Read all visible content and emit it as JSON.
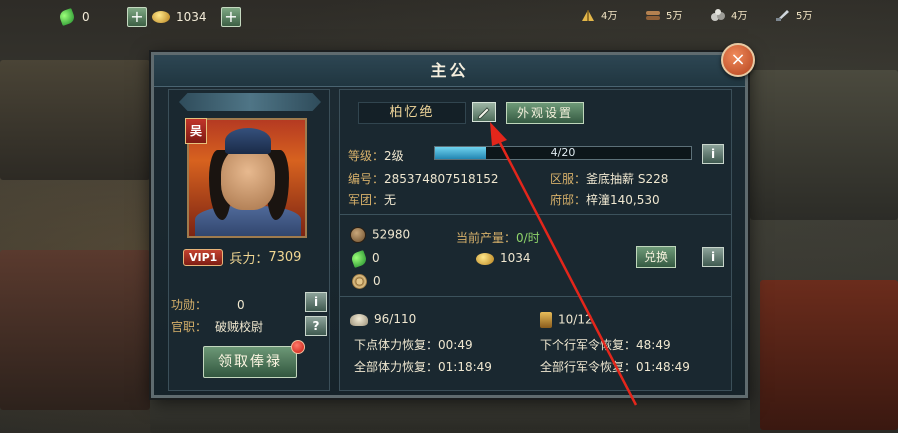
{
  "topbar": {
    "gems": "0",
    "gold": "1034",
    "plus_label": "+",
    "resources": [
      {
        "icon": "grain-icon",
        "value": "4万"
      },
      {
        "icon": "wood-icon",
        "value": "5万"
      },
      {
        "icon": "stone-icon",
        "value": "4万"
      },
      {
        "icon": "iron-icon",
        "value": "5万"
      }
    ]
  },
  "panel": {
    "title": "主公",
    "close_label": "×"
  },
  "profile": {
    "faction": "吴",
    "vip": "VIP1",
    "troops_label": "兵力：",
    "troops_value": "7309",
    "merit_label": "功勋：",
    "merit_value": "0",
    "office_label": "官职：",
    "office_value": "破贼校尉",
    "info_label": "i",
    "help_label": "?",
    "salary_button": "领取俸禄"
  },
  "details": {
    "name": "柏忆绝",
    "appearance_button": "外观设置",
    "level_label": "等级：",
    "level_value": "2级",
    "xp_text": "4/20",
    "xp_fraction": 0.2,
    "id_label": "编号：",
    "id_value": "285374807518152",
    "server_label": "区服：",
    "server_value": "釜底抽薪 S228",
    "legion_label": "军团：",
    "legion_value": "无",
    "mansion_label": "府邸：",
    "mansion_value": "梓潼140,530",
    "info_label": "i"
  },
  "wealth": {
    "copper": "52980",
    "production_label": "当前产量：",
    "production_value": "0/时",
    "gems": "0",
    "gold": "1034",
    "coil": "0",
    "exchange_button": "兑换",
    "info_label": "i"
  },
  "stamina": {
    "stamina_value": "96/110",
    "orders_value": "10/12",
    "next_stamina_label": "下点体力恢复：",
    "next_stamina_value": "00:49",
    "all_stamina_label": "全部体力恢复：",
    "all_stamina_value": "01:18:49",
    "next_order_label": "下个行军令恢复：",
    "next_order_value": "48:49",
    "all_order_label": "全部行军令恢复：",
    "all_order_value": "01:48:49"
  },
  "colors": {
    "accent_gold": "#d6b06a",
    "button_green": "#4d7a5a",
    "annotation_red": "#e3261b"
  }
}
